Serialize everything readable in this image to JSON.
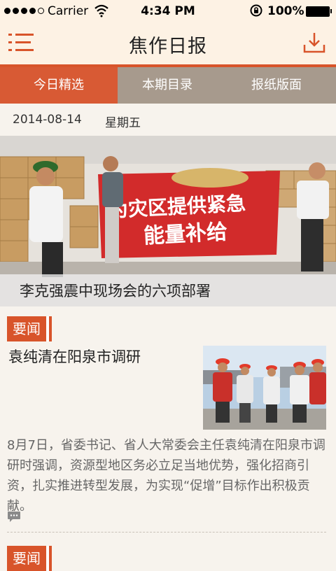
{
  "status_bar": {
    "carrier": "Carrier",
    "time": "4:34 PM",
    "battery": "100%"
  },
  "nav": {
    "title": "焦作日报",
    "menu_icon": "hamburger-menu-icon",
    "download_icon": "download-icon"
  },
  "tabs": [
    {
      "label": "今日精选",
      "active": true
    },
    {
      "label": "本期目录",
      "active": false
    },
    {
      "label": "报纸版面",
      "active": false
    }
  ],
  "date_row": {
    "date": "2014-08-14",
    "weekday": "星期五"
  },
  "hero": {
    "caption": "李克强震中现场会的六项部署",
    "banner_line1": "为灾区提供紧急",
    "banner_line2": "能量补给"
  },
  "news": [
    {
      "category": "要闻",
      "title": "袁纯清在阳泉市调研",
      "summary": "8月7日，省委书记、省人大常委会主任袁纯清在阳泉市调研时强调，资源型地区务必立足当地优势，强化招商引资，扎实推进转型发展，为实现“促增”目标作出积极贡献。"
    },
    {
      "category": "要闻"
    }
  ],
  "colors": {
    "accent": "#d8542a",
    "tab_inactive": "#a79a8d",
    "header_bg": "#fdf2e4",
    "page_bg": "#f7f3ed"
  }
}
